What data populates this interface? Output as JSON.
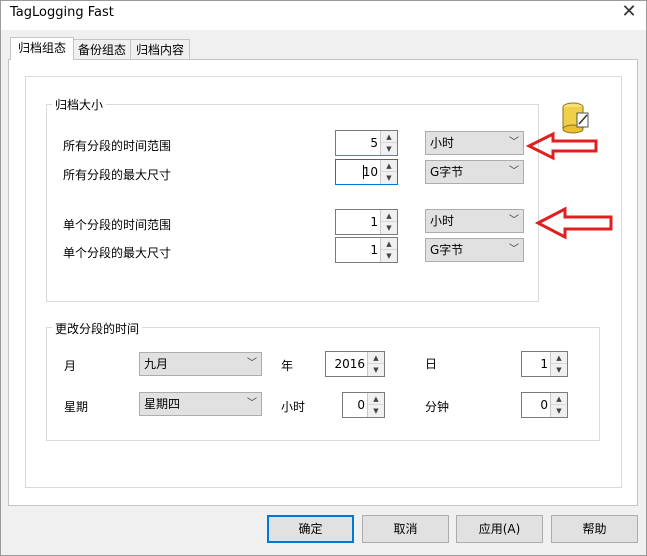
{
  "window": {
    "title": "TagLogging Fast",
    "close_glyph": "✕"
  },
  "tabs": [
    {
      "label": "归档组态",
      "active": true
    },
    {
      "label": "备份组态",
      "active": false
    },
    {
      "label": "归档内容",
      "active": false
    }
  ],
  "archive_size": {
    "title": "归档大小",
    "all_time_range": {
      "label": "所有分段的时间范围",
      "value": "5",
      "unit": "小时"
    },
    "all_max_size": {
      "label": "所有分段的最大尺寸",
      "value": "10",
      "unit": "G字节"
    },
    "single_time_range": {
      "label": "单个分段的时间范围",
      "value": "1",
      "unit": "小时"
    },
    "single_max_size": {
      "label": "单个分段的最大尺寸",
      "value": "1",
      "unit": "G字节"
    }
  },
  "segment_change": {
    "title": "更改分段的时间",
    "month": {
      "label": "月",
      "value": "九月"
    },
    "year": {
      "label": "年",
      "value": "2016"
    },
    "day": {
      "label": "日",
      "value": "1"
    },
    "weekday": {
      "label": "星期",
      "value": "星期四"
    },
    "hour": {
      "label": "小时",
      "value": "0"
    },
    "minute": {
      "label": "分钟",
      "value": "0"
    }
  },
  "buttons": {
    "ok": "确定",
    "cancel": "取消",
    "apply": "应用(A)",
    "help": "帮助"
  },
  "icons": {
    "database": "database-icon",
    "annotation": "red-arrow-icon"
  },
  "colors": {
    "annotation": "#e02020",
    "focus": "#0078d7",
    "database": "#f0d048"
  }
}
